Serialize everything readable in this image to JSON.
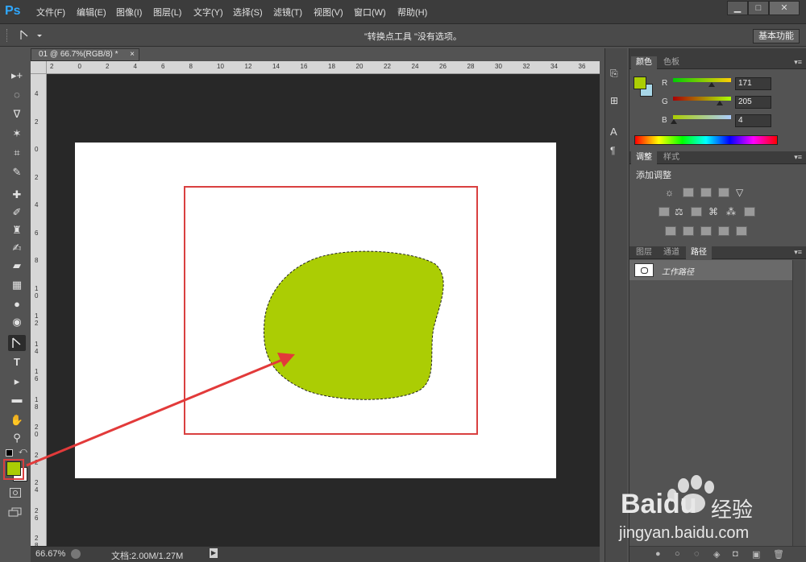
{
  "app": {
    "logo": "Ps"
  },
  "menus": [
    "文件(F)",
    "编辑(E)",
    "图像(I)",
    "图层(L)",
    "文字(Y)",
    "选择(S)",
    "滤镜(T)",
    "视图(V)",
    "窗口(W)",
    "帮助(H)"
  ],
  "window_buttons": [
    "▁",
    "□",
    "✕"
  ],
  "options_bar": {
    "hint": "\"转换点工具 \"没有选项。",
    "workspace": "基本功能"
  },
  "document": {
    "tab_title": "01 @ 66.7%(RGB/8) *",
    "tab_close": "×"
  },
  "ruler": {
    "top": [
      "2",
      "0",
      "2",
      "4",
      "6",
      "8",
      "10",
      "12",
      "14",
      "16",
      "18",
      "20",
      "22",
      "24",
      "26",
      "28",
      "30",
      "32",
      "34",
      "36"
    ],
    "left": [
      "4",
      "2",
      "0",
      "2",
      "4",
      "6",
      "8",
      "1 0",
      "1 2",
      "1 4",
      "1 6",
      "1 8",
      "2 0",
      "2 2",
      "2 4",
      "2 6",
      "2 8"
    ]
  },
  "status": {
    "zoom": "66.67%",
    "doc": "文档:2.00M/1.27M"
  },
  "color_panel": {
    "tabs": [
      "颜色",
      "色板"
    ],
    "fg": "#abcd04",
    "bg": "#a8d7e8",
    "r_label": "R",
    "g_label": "G",
    "b_label": "B",
    "r": "171",
    "g": "205",
    "b": "4",
    "r_frac": 0.67,
    "g_frac": 0.8,
    "b_frac": 0.02
  },
  "adjust_panel": {
    "tabs": [
      "调整",
      "样式"
    ],
    "title": "添加调整"
  },
  "layers_panel": {
    "tabs": [
      "图层",
      "通道",
      "路径"
    ],
    "path_name": "工作路径"
  },
  "tools": {
    "active": "convert-point-tool",
    "fg_color": "#abcd04"
  },
  "watermark": {
    "brand": "Bai",
    "brand2": "du",
    "cn": "经验",
    "url": "jingyan.baidu.com"
  },
  "colors": {
    "shape_fill": "#abcd04",
    "highlight": "#d94040"
  }
}
